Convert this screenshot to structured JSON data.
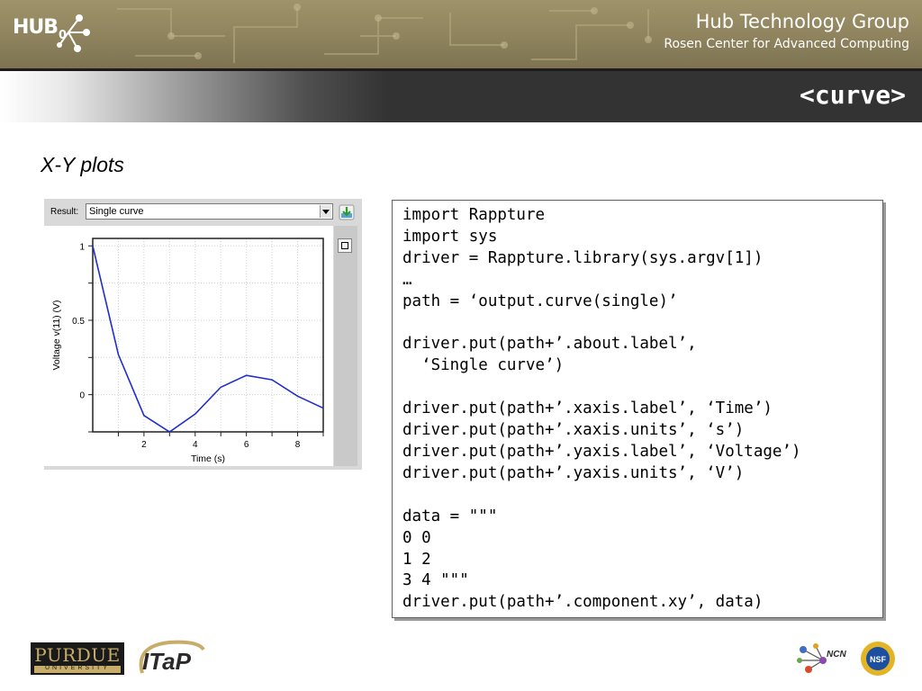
{
  "header": {
    "logo_text": "HUB",
    "logo_sub": "0",
    "org_name": "Hub Technology Group",
    "org_subtitle": "Rosen Center for Advanced Computing"
  },
  "slide": {
    "title": "<curve>",
    "subtitle": "X-Y plots"
  },
  "result_panel": {
    "result_label": "Result:",
    "selected": "Single curve",
    "icons": [
      "download-icon",
      "zoom-reset-icon"
    ]
  },
  "chart_data": {
    "type": "line",
    "title": "",
    "xlabel": "Time (s)",
    "ylabel": "Voltage v(11) (V)",
    "xlim": [
      0,
      9
    ],
    "ylim": [
      -0.25,
      1.05
    ],
    "xticks": [
      2,
      4,
      6,
      8
    ],
    "yticks": [
      0,
      0.5,
      1
    ],
    "grid": true,
    "series": [
      {
        "x": [
          0,
          1,
          2,
          3,
          4,
          5,
          6,
          7,
          8,
          9
        ],
        "y": [
          1.0,
          0.27,
          -0.14,
          -0.25,
          -0.13,
          0.05,
          0.13,
          0.1,
          -0.01,
          -0.09
        ],
        "color": "#1f2ecc"
      }
    ]
  },
  "code": {
    "lines": [
      "import Rappture",
      "import sys",
      "driver = Rappture.library(sys.argv[1])",
      "…",
      "path = ‘output.curve(single)’",
      "",
      "driver.put(path+’.about.label’,",
      "  ‘Single curve’)",
      "",
      "driver.put(path+’.xaxis.label’, ‘Time’)",
      "driver.put(path+’.xaxis.units’, ‘s’)",
      "driver.put(path+’.yaxis.label’, ‘Voltage’)",
      "driver.put(path+’.yaxis.units’, ‘V’)",
      "",
      "data = \"\"\"",
      "0 0",
      "1 2",
      "3 4 \"\"\"",
      "driver.put(path+’.component.xy’, data)"
    ]
  },
  "footer": {
    "purdue_name": "PURDUE",
    "purdue_sub": "UNIVERSITY",
    "itap": "ITaP",
    "ncn": "NCN",
    "nsf": "NSF"
  }
}
